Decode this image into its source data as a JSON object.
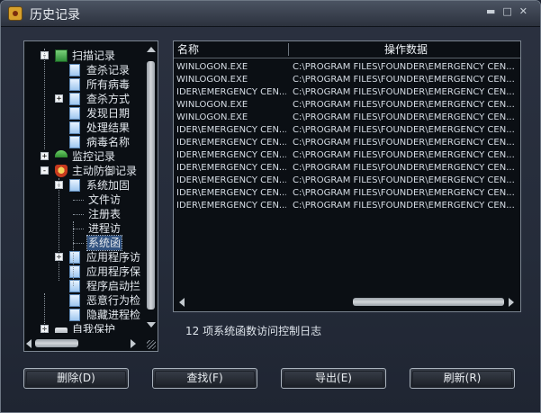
{
  "window": {
    "title": "历史记录"
  },
  "tree": {
    "nodes": [
      {
        "label": "扫描记录",
        "level": 1,
        "expander": "-",
        "icon": "scan-icon"
      },
      {
        "label": "查杀记录",
        "level": 2,
        "icon": "document-icon"
      },
      {
        "label": "所有病毒",
        "level": 2,
        "icon": "document-icon"
      },
      {
        "label": "查杀方式",
        "level": 2,
        "expander": "+",
        "icon": "document-icon"
      },
      {
        "label": "发现日期",
        "level": 2,
        "icon": "document-icon"
      },
      {
        "label": "处理结果",
        "level": 2,
        "icon": "document-icon"
      },
      {
        "label": "病毒名称",
        "level": 2,
        "icon": "document-icon"
      },
      {
        "label": "监控记录",
        "level": 1,
        "expander": "+",
        "icon": "umbrella-icon"
      },
      {
        "label": "主动防御记录",
        "level": 1,
        "expander": "-",
        "icon": "shield-icon"
      },
      {
        "label": "系统加固",
        "level": 2,
        "expander": "-",
        "icon": "document-icon"
      },
      {
        "label": "文件访",
        "level": 3
      },
      {
        "label": "注册表",
        "level": 3
      },
      {
        "label": "进程访",
        "level": 3
      },
      {
        "label": "系统函",
        "level": 3,
        "selected": true
      },
      {
        "label": "应用程序访",
        "level": 2,
        "expander": "+",
        "icon": "document-icon"
      },
      {
        "label": "应用程序保",
        "level": 2,
        "icon": "document-icon"
      },
      {
        "label": "程序启动拦",
        "level": 2,
        "icon": "document-icon"
      },
      {
        "label": "恶意行为检",
        "level": 2,
        "icon": "document-icon"
      },
      {
        "label": "隐藏进程检",
        "level": 2,
        "icon": "document-icon"
      },
      {
        "label": "自我保护",
        "level": 1,
        "expander": "+",
        "icon": "lock-icon"
      }
    ]
  },
  "list": {
    "columns": [
      "名称",
      "操作数据"
    ],
    "rows": [
      [
        "WINLOGON.EXE",
        "C:\\PROGRAM FILES\\FOUNDER\\EMERGENCY CEN..."
      ],
      [
        "WINLOGON.EXE",
        "C:\\PROGRAM FILES\\FOUNDER\\EMERGENCY CEN..."
      ],
      [
        "IDER\\EMERGENCY CEN...",
        "C:\\PROGRAM FILES\\FOUNDER\\EMERGENCY CEN..."
      ],
      [
        "WINLOGON.EXE",
        "C:\\PROGRAM FILES\\FOUNDER\\EMERGENCY CEN..."
      ],
      [
        "WINLOGON.EXE",
        "C:\\PROGRAM FILES\\FOUNDER\\EMERGENCY CEN..."
      ],
      [
        "IDER\\EMERGENCY CEN...",
        "C:\\PROGRAM FILES\\FOUNDER\\EMERGENCY CEN..."
      ],
      [
        "IDER\\EMERGENCY CEN...",
        "C:\\PROGRAM FILES\\FOUNDER\\EMERGENCY CEN..."
      ],
      [
        "IDER\\EMERGENCY CEN...",
        "C:\\PROGRAM FILES\\FOUNDER\\EMERGENCY CEN..."
      ],
      [
        "IDER\\EMERGENCY CEN...",
        "C:\\PROGRAM FILES\\FOUNDER\\EMERGENCY CEN..."
      ],
      [
        "IDER\\EMERGENCY CEN...",
        "C:\\PROGRAM FILES\\FOUNDER\\EMERGENCY CEN..."
      ],
      [
        "IDER\\EMERGENCY CEN...",
        "C:\\PROGRAM FILES\\FOUNDER\\EMERGENCY CEN..."
      ],
      [
        "IDER\\EMERGENCY CEN...",
        "C:\\PROGRAM FILES\\FOUNDER\\EMERGENCY CEN..."
      ]
    ]
  },
  "status": "12 项系统函数访问控制日志",
  "buttons": {
    "delete": "删除(D)",
    "find": "查找(F)",
    "export": "导出(E)",
    "refresh": "刷新(R)"
  },
  "colors": {
    "background": "#252c3a",
    "panel": "#0b0f14",
    "selection": "#31527f"
  }
}
